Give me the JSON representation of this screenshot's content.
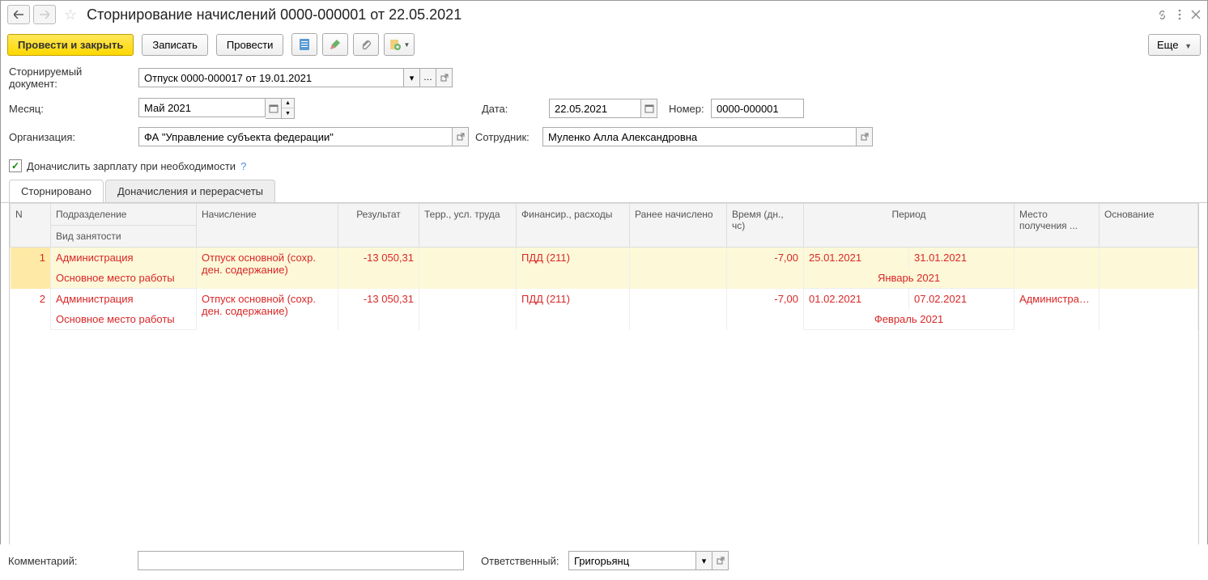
{
  "window": {
    "title": "Сторнирование начислений 0000-000001 от 22.05.2021"
  },
  "toolbar": {
    "post_and_close": "Провести и закрыть",
    "write": "Записать",
    "post": "Провести",
    "more": "Еще"
  },
  "form": {
    "storn_doc_label": "Сторнируемый документ:",
    "storn_doc_value": "Отпуск 0000-000017 от 19.01.2021",
    "month_label": "Месяц:",
    "month_value": "Май 2021",
    "date_label": "Дата:",
    "date_value": "22.05.2021",
    "number_label": "Номер:",
    "number_value": "0000-000001",
    "org_label": "Организация:",
    "org_value": "ФА \"Управление субъекта федерации\"",
    "employee_label": "Сотрудник:",
    "employee_value": "Муленко Алла Александровна",
    "recalc_checkbox": "Доначислить зарплату при необходимости"
  },
  "tabs": {
    "tab1": "Сторнировано",
    "tab2": "Доначисления и перерасчеты"
  },
  "table": {
    "headers": {
      "n": "N",
      "dept": "Подразделение",
      "employment": "Вид занятости",
      "accrual": "Начисление",
      "result": "Результат",
      "terr": "Терр., усл. труда",
      "finance": "Финансир., расходы",
      "prev": "Ранее начислено",
      "time": "Время (дн., чс)",
      "period": "Период",
      "place": "Место получения ...",
      "basis": "Основание"
    },
    "rows": [
      {
        "n": "1",
        "dept": "Администрация",
        "employment": "Основное место работы",
        "accrual": "Отпуск основной (сохр. ден. содержание)",
        "result": "-13 050,31",
        "finance": "ПДД (211)",
        "time": "-7,00",
        "period_from": "25.01.2021",
        "period_to": "31.01.2021",
        "period_month": "Январь 2021",
        "place": ""
      },
      {
        "n": "2",
        "dept": "Администрация",
        "employment": "Основное место работы",
        "accrual": "Отпуск основной (сохр. ден. содержание)",
        "result": "-13 050,31",
        "finance": "ПДД (211)",
        "time": "-7,00",
        "period_from": "01.02.2021",
        "period_to": "07.02.2021",
        "period_month": "Февраль 2021",
        "place": "Администра…"
      }
    ]
  },
  "footer": {
    "comment_label": "Комментарий:",
    "responsible_label": "Ответственный:",
    "responsible_value": "Григорьянц"
  }
}
